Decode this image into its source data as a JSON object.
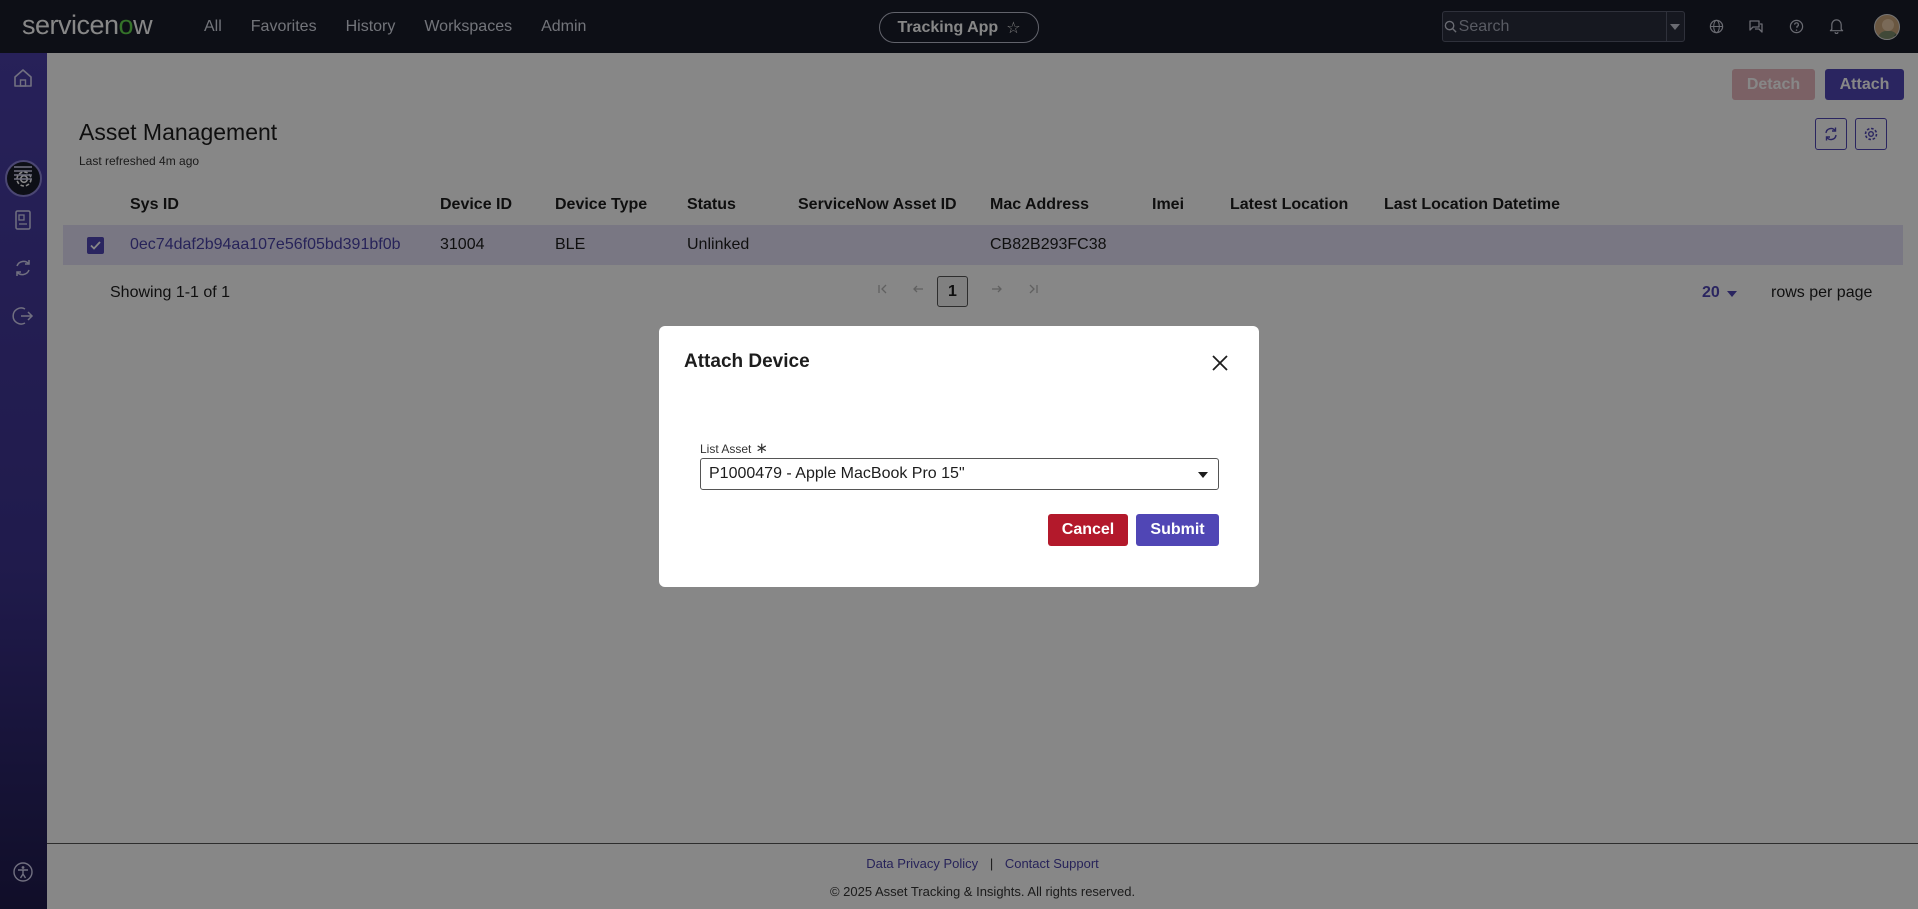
{
  "topnav": {
    "logo_text": "servicenow",
    "links": [
      "All",
      "Favorites",
      "History",
      "Workspaces",
      "Admin"
    ],
    "app_pill": "Tracking App",
    "search_placeholder": "Search"
  },
  "toolbar": {
    "detach_label": "Detach",
    "attach_label": "Attach"
  },
  "page": {
    "title": "Asset Management",
    "subtitle": "Last refreshed 4m ago"
  },
  "table": {
    "columns": [
      "Sys ID",
      "Device ID",
      "Device Type",
      "Status",
      "ServiceNow Asset ID",
      "Mac Address",
      "Imei",
      "Latest Location",
      "Last Location Datetime"
    ],
    "rows": [
      {
        "sys_id": "0ec74daf2b94aa107e56f05bd391bf0b",
        "device_id": "31004",
        "device_type": "BLE",
        "status": "Unlinked",
        "servicenow_asset_id": "",
        "mac_address": "CB82B293FC38",
        "imei": "",
        "latest_location": "",
        "last_location_datetime": ""
      }
    ]
  },
  "pager": {
    "showing": "Showing 1-1 of 1",
    "current_page": "1",
    "rows_per_page": "20",
    "rows_per_page_label": "rows per page"
  },
  "footer": {
    "privacy": "Data Privacy Policy",
    "separator": "|",
    "support": "Contact Support",
    "copyright": "© 2025 Asset Tracking & Insights. All rights reserved."
  },
  "modal": {
    "title": "Attach Device",
    "field_label": "List Asset",
    "field_value": "P1000479 - Apple MacBook Pro 15\"",
    "cancel_label": "Cancel",
    "submit_label": "Submit"
  },
  "colors": {
    "brand_purple": "#5046b5",
    "cancel_red": "#b3192b",
    "nav_dark": "#1a1d2b",
    "logo_green": "#62d84e"
  }
}
